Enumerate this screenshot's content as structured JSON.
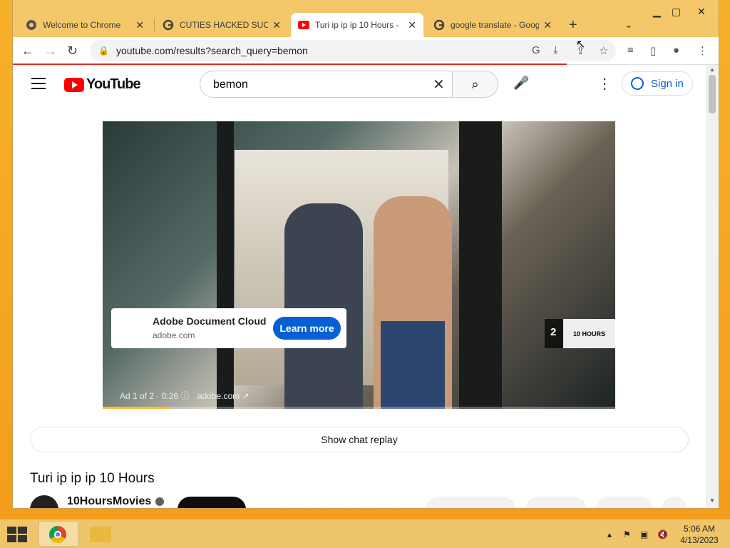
{
  "browser": {
    "tabs": [
      {
        "title": "Welcome to Chrome",
        "icon": "chrome-globe-icon",
        "active": false
      },
      {
        "title": "CUTIES HACKED SUCKS",
        "icon": "google-icon",
        "active": false
      },
      {
        "title": "Turi ip ip ip 10 Hours -",
        "icon": "youtube-icon",
        "active": true
      },
      {
        "title": "google translate - Goog",
        "icon": "google-icon",
        "active": false
      }
    ],
    "url": "youtube.com/results?search_query=bemon"
  },
  "youtube": {
    "logo_text": "YouTube",
    "search": {
      "value": "bemon",
      "placeholder": "Search"
    },
    "sign_in_label": "Sign in"
  },
  "ad": {
    "title": "Adobe Document Cloud",
    "domain": "adobe.com",
    "cta": "Learn more",
    "info": "Ad 1 of 2 · 0:26",
    "info_domain": "adobe.com",
    "next_count": "2",
    "next_thumb_text": "10 HOURS",
    "progress": 0.13
  },
  "video": {
    "show_chat_replay": "Show chat replay",
    "title": "Turi ip ip ip 10 Hours",
    "channel": "10HoursMovies"
  },
  "taskbar": {
    "time": "5:06 AM",
    "date": "4/13/2023"
  },
  "colors": {
    "accent": "#065fd4",
    "youtube_red": "#ff0000",
    "desktop": "#f5a623"
  }
}
